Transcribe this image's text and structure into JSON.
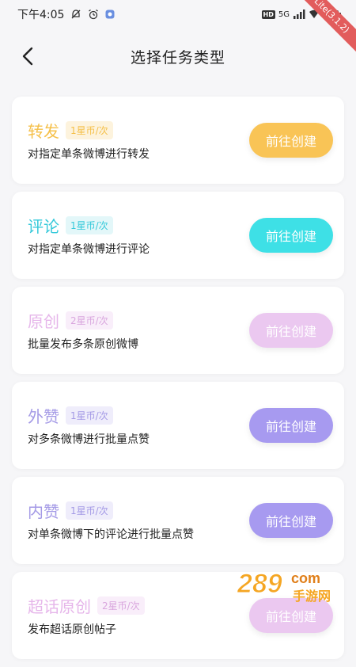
{
  "status_bar": {
    "time": "下午4:05",
    "network": "5G",
    "hd": "HD",
    "battery_level": 0.9
  },
  "ribbon": {
    "text": "Lite(3.1.2)"
  },
  "header": {
    "title": "选择任务类型"
  },
  "cards": [
    {
      "title": "转发",
      "price": "1星币/次",
      "desc": "对指定单条微博进行转发",
      "button": "前往创建",
      "title_color": "#f5c04a",
      "tag_bg": "#fdf3dd",
      "tag_color": "#f5c04a",
      "button_color": "#f9c456"
    },
    {
      "title": "评论",
      "price": "1星币/次",
      "desc": "对指定单条微博进行评论",
      "button": "前往创建",
      "title_color": "#35c9da",
      "tag_bg": "#e3f7f9",
      "tag_color": "#35c9da",
      "button_color": "#3ee0e6"
    },
    {
      "title": "原创",
      "price": "2星币/次",
      "desc": "批量发布多条原创微博",
      "button": "前往创建",
      "title_color": "#e6b6ea",
      "tag_bg": "#f9eefa",
      "tag_color": "#d9a6de",
      "button_color": "#ebc8f0"
    },
    {
      "title": "外赞",
      "price": "1星币/次",
      "desc": "对多条微博进行批量点赞",
      "button": "前往创建",
      "title_color": "#a49ae6",
      "tag_bg": "#efedfb",
      "tag_color": "#a49ae6",
      "button_color": "#a79af0"
    },
    {
      "title": "内赞",
      "price": "1星币/次",
      "desc": "对单条微博下的评论进行批量点赞",
      "button": "前往创建",
      "title_color": "#a49ae6",
      "tag_bg": "#efedfb",
      "tag_color": "#a49ae6",
      "button_color": "#a79af0"
    },
    {
      "title": "超话原创",
      "price": "2星币/次",
      "desc": "发布超话原创帖子",
      "button": "前往创建",
      "title_color": "#e6b6ea",
      "tag_bg": "#f9eefa",
      "tag_color": "#d9a6de",
      "button_color": "#ebc8f0"
    }
  ],
  "watermark": {
    "number": "289",
    "suffix": "com",
    "sub": "手游网",
    "color": "#f5a623"
  }
}
